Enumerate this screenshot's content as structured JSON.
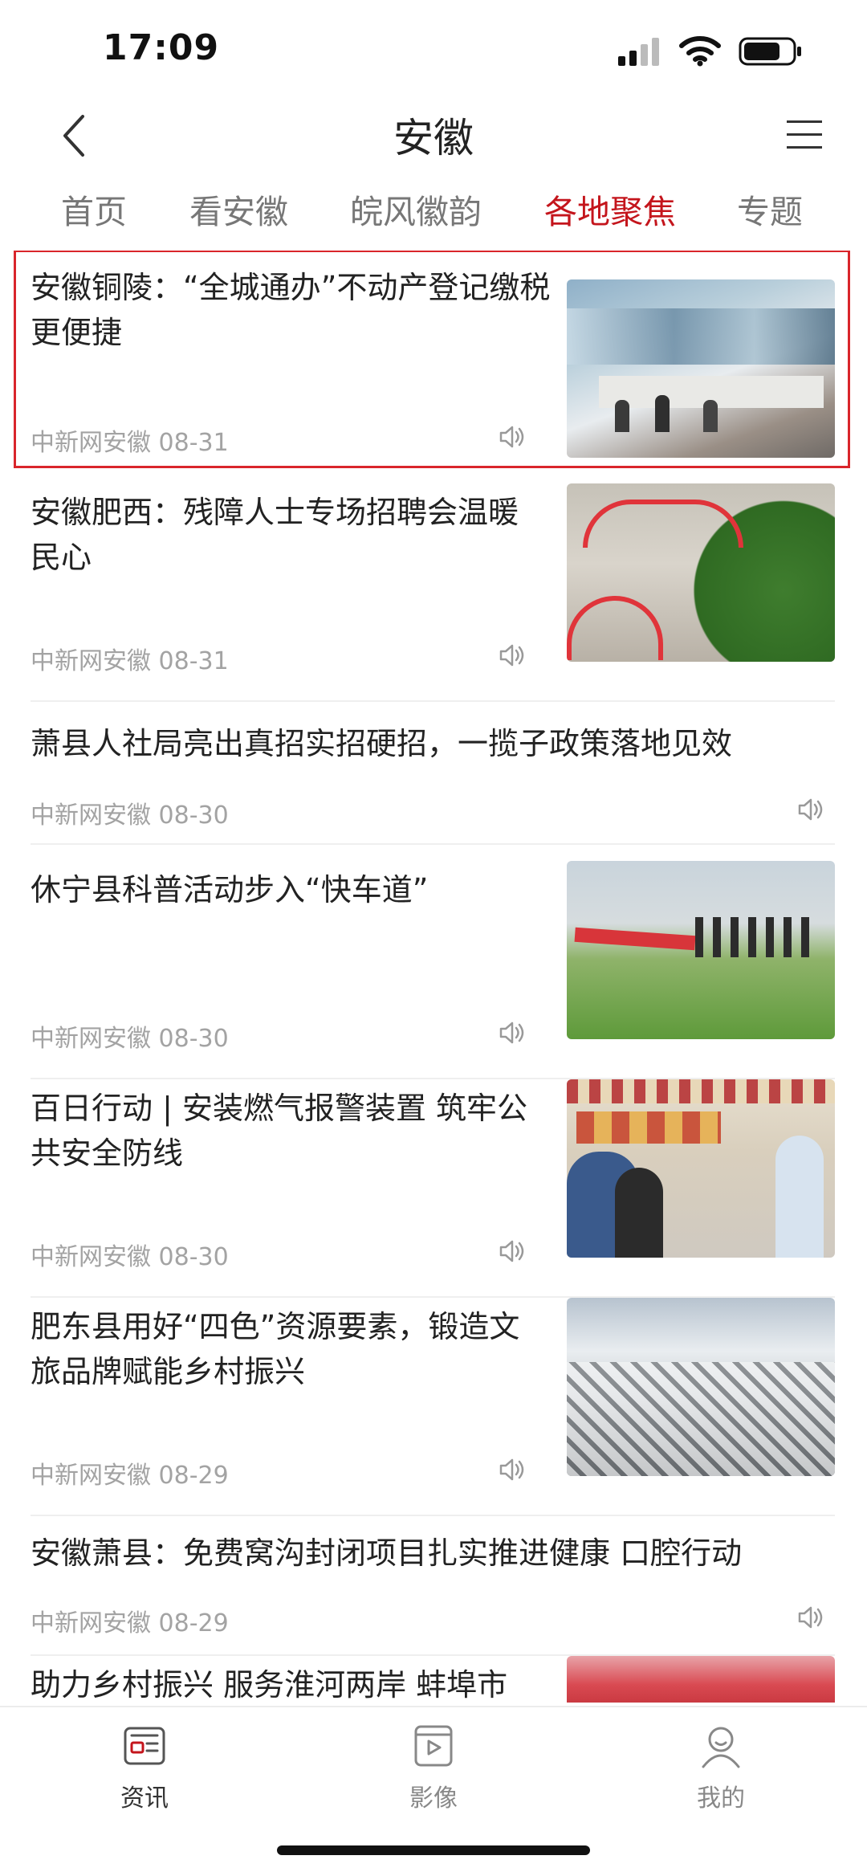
{
  "status": {
    "time": "17:09"
  },
  "nav": {
    "title": "安徽"
  },
  "tabs": [
    {
      "label": "首页",
      "active": false
    },
    {
      "label": "看安徽",
      "active": false
    },
    {
      "label": "皖风徽韵",
      "active": false
    },
    {
      "label": "各地聚焦",
      "active": true
    },
    {
      "label": "专题",
      "active": false
    }
  ],
  "feed": [
    {
      "title": "安徽铜陵：“全城通办”不动产登记缴税更便捷",
      "source": "中新网安徽",
      "date": "08-31",
      "image": "service-hall-photo",
      "selected": true
    },
    {
      "title": "安徽肥西：残障人士专场招聘会温暖民心",
      "source": "中新网安徽",
      "date": "08-31",
      "image": "job-fair-photo"
    },
    {
      "title": "萧县人社局亮出真招实招硬招，一揽子政策落地见效",
      "source": "中新网安徽",
      "date": "08-30",
      "image": ""
    },
    {
      "title": "休宁县科普活动步入“快车道”",
      "source": "中新网安徽",
      "date": "08-30",
      "image": "field-banner-photo"
    },
    {
      "title": "百日行动 | 安装燃气报警装置 筑牢公共安全防线",
      "source": "中新网安徽",
      "date": "08-30",
      "image": "kitchen-inspection-photo"
    },
    {
      "title": "肥东县用好“四色”资源要素，锻造文旅品牌赋能乡村振兴",
      "source": "中新网安徽",
      "date": "08-29",
      "image": "snow-village-photo"
    },
    {
      "title": "安徽萧县：免费窝沟封闭项目扎实推进健康 口腔行动",
      "source": "中新网安徽",
      "date": "08-29",
      "image": ""
    },
    {
      "title": "助力乡村振兴  服务淮河两岸 蚌埠市",
      "source": "",
      "date": "",
      "image": "partial-photo"
    }
  ],
  "tabbar": [
    {
      "label": "资讯",
      "icon": "news-icon",
      "active": true
    },
    {
      "label": "影像",
      "icon": "video-icon",
      "active": false
    },
    {
      "label": "我的",
      "icon": "profile-icon",
      "active": false
    }
  ],
  "colors": {
    "accent": "#c4151c",
    "highlight_border": "#d9252b",
    "meta_text": "#a3a3a3"
  }
}
